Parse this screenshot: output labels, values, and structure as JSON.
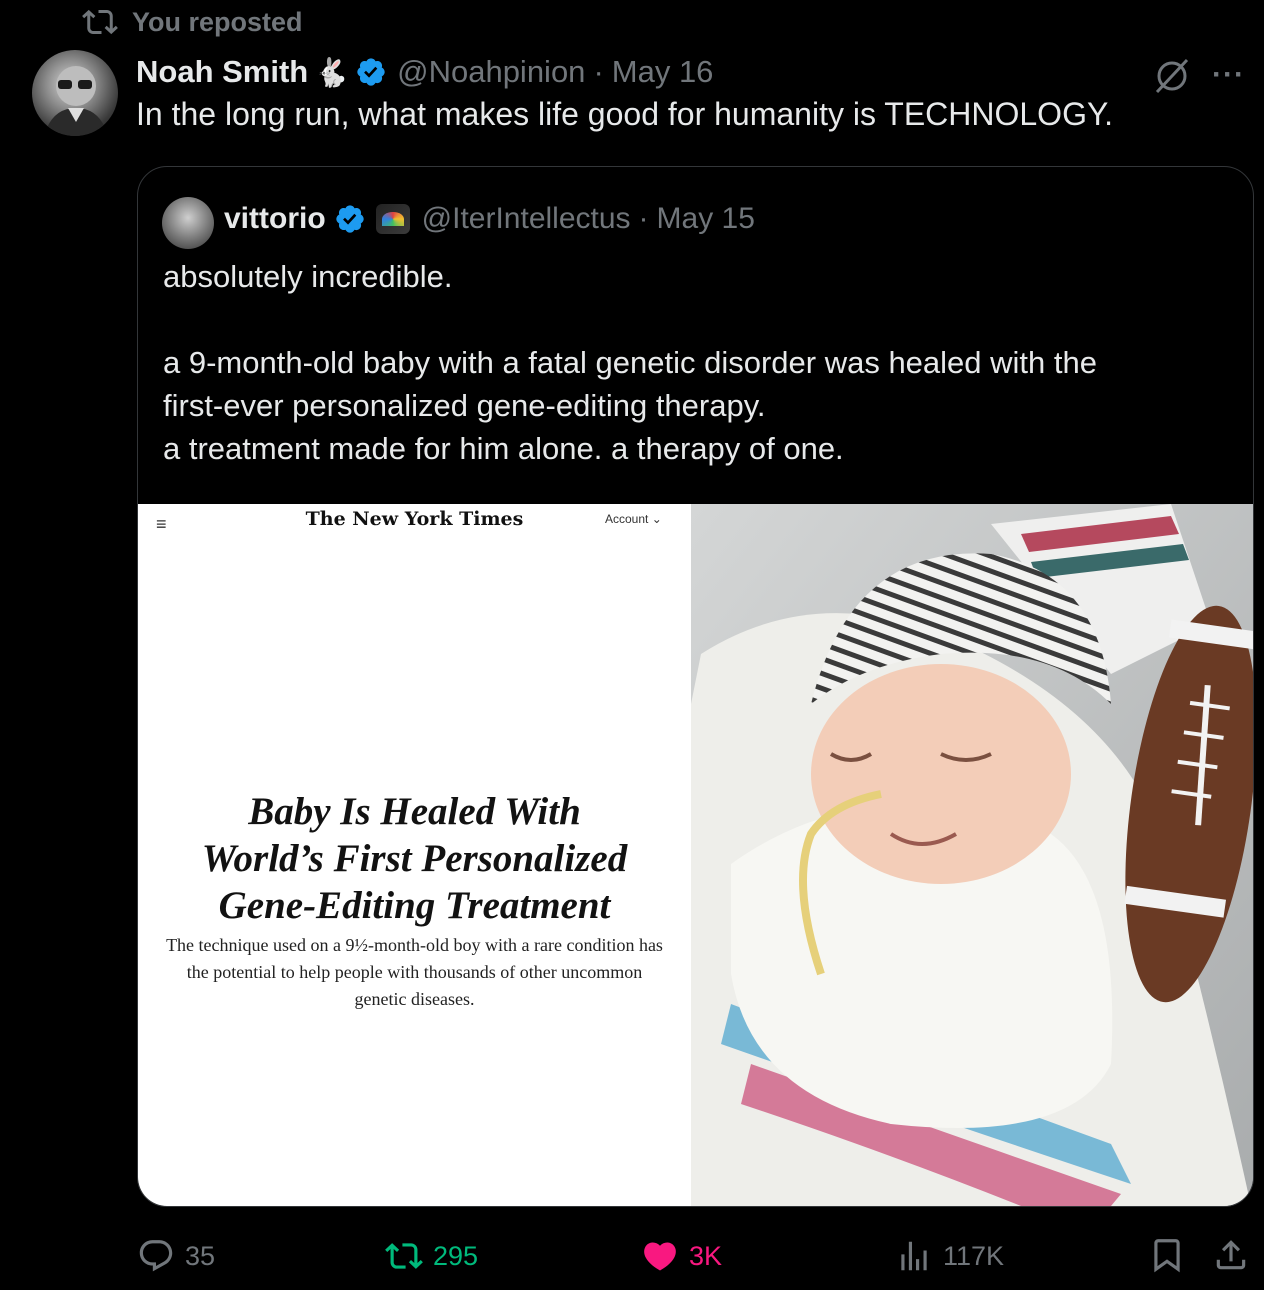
{
  "repost": {
    "label": "You reposted"
  },
  "post": {
    "author_name": "Noah Smith",
    "author_emoji": "🐇",
    "handle": "@Noahpinion",
    "separator": "·",
    "date": "May 16",
    "text": "In the long run, what makes life good for humanity is TECHNOLOGY.",
    "more": "···"
  },
  "quote": {
    "author_name": "vittorio",
    "handle": "@IterIntellectus",
    "separator": "·",
    "date": "May 15",
    "text": "absolutely incredible.\n\na 9-month-old baby with a fatal genetic disorder was healed with the\nfirst-ever personalized gene-editing therapy.\na treatment made for him alone. a therapy of one.",
    "media": {
      "nyt_menu": "≡",
      "nyt_logo": "The New York Times",
      "nyt_account": "Account ⌄",
      "headline": "Baby Is Healed With\nWorld’s First Personalized\nGene-Editing Treatment",
      "subhead": "The technique used on a 9½-month-old boy with a rare condition has the potential to help people with thousands of other uncommon genetic diseases."
    }
  },
  "actions": {
    "replies": "35",
    "reposts": "295",
    "likes": "3K",
    "views": "117K"
  },
  "colors": {
    "repost_green": "#00ba7c",
    "like_pink": "#f91880",
    "muted": "#71767b",
    "verified_blue": "#1d9bf0"
  }
}
